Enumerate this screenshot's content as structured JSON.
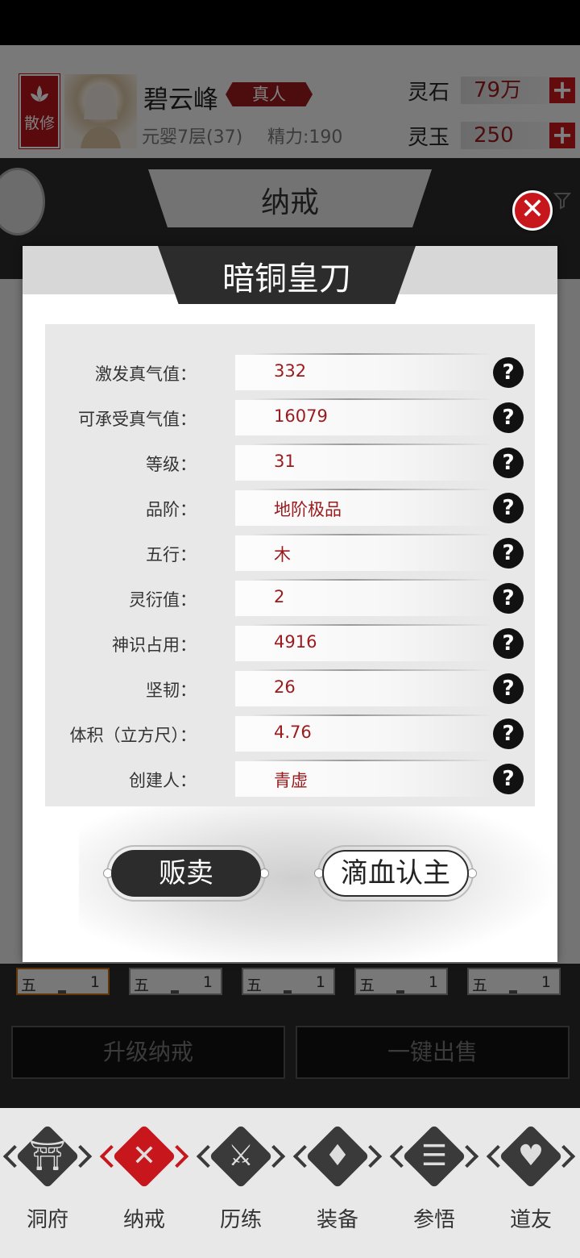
{
  "player": {
    "sect_label": "散修",
    "name": "碧云峰",
    "rank_badge": "真人",
    "realm": "元婴7层(37)",
    "energy": "精力:190"
  },
  "currency": [
    {
      "label": "灵石",
      "value": "79万"
    },
    {
      "label": "灵玉",
      "value": "250"
    }
  ],
  "page": {
    "title": "纳戒"
  },
  "item_modal": {
    "title": "暗铜皇刀",
    "attributes": [
      {
        "key": "激发真气值：",
        "value": "332"
      },
      {
        "key": "可承受真气值：",
        "value": "16079"
      },
      {
        "key": "等级：",
        "value": "31"
      },
      {
        "key": "品阶：",
        "value": "地阶极品"
      },
      {
        "key": "五行：",
        "value": "木"
      },
      {
        "key": "灵衍值：",
        "value": "2"
      },
      {
        "key": "神识占用：",
        "value": "4916"
      },
      {
        "key": "坚韧：",
        "value": "26"
      },
      {
        "key": "体积（立方尺）：",
        "value": "4.76"
      },
      {
        "key": "创建人：",
        "value": "青虚"
      }
    ],
    "sell_label": "贩卖",
    "bind_label": "滴血认主"
  },
  "slots": [
    {
      "element": "五",
      "count": "1"
    },
    {
      "element": "五",
      "count": "1"
    },
    {
      "element": "五",
      "count": "1"
    },
    {
      "element": "五",
      "count": "1"
    },
    {
      "element": "五",
      "count": "1"
    }
  ],
  "actions": {
    "upgrade_label": "升级纳戒",
    "sell_all_label": "一键出售"
  },
  "nav": [
    {
      "label": "洞府",
      "icon": "pavilion-icon"
    },
    {
      "label": "纳戒",
      "icon": "crossed-swords-icon"
    },
    {
      "label": "历练",
      "icon": "battle-icon"
    },
    {
      "label": "装备",
      "icon": "sword-icon"
    },
    {
      "label": "参悟",
      "icon": "book-icon"
    },
    {
      "label": "道友",
      "icon": "handshake-icon"
    }
  ],
  "colors": {
    "accent_red": "#c8161d",
    "value_red": "#9b1a1d",
    "dark": "#2c2c2c"
  }
}
